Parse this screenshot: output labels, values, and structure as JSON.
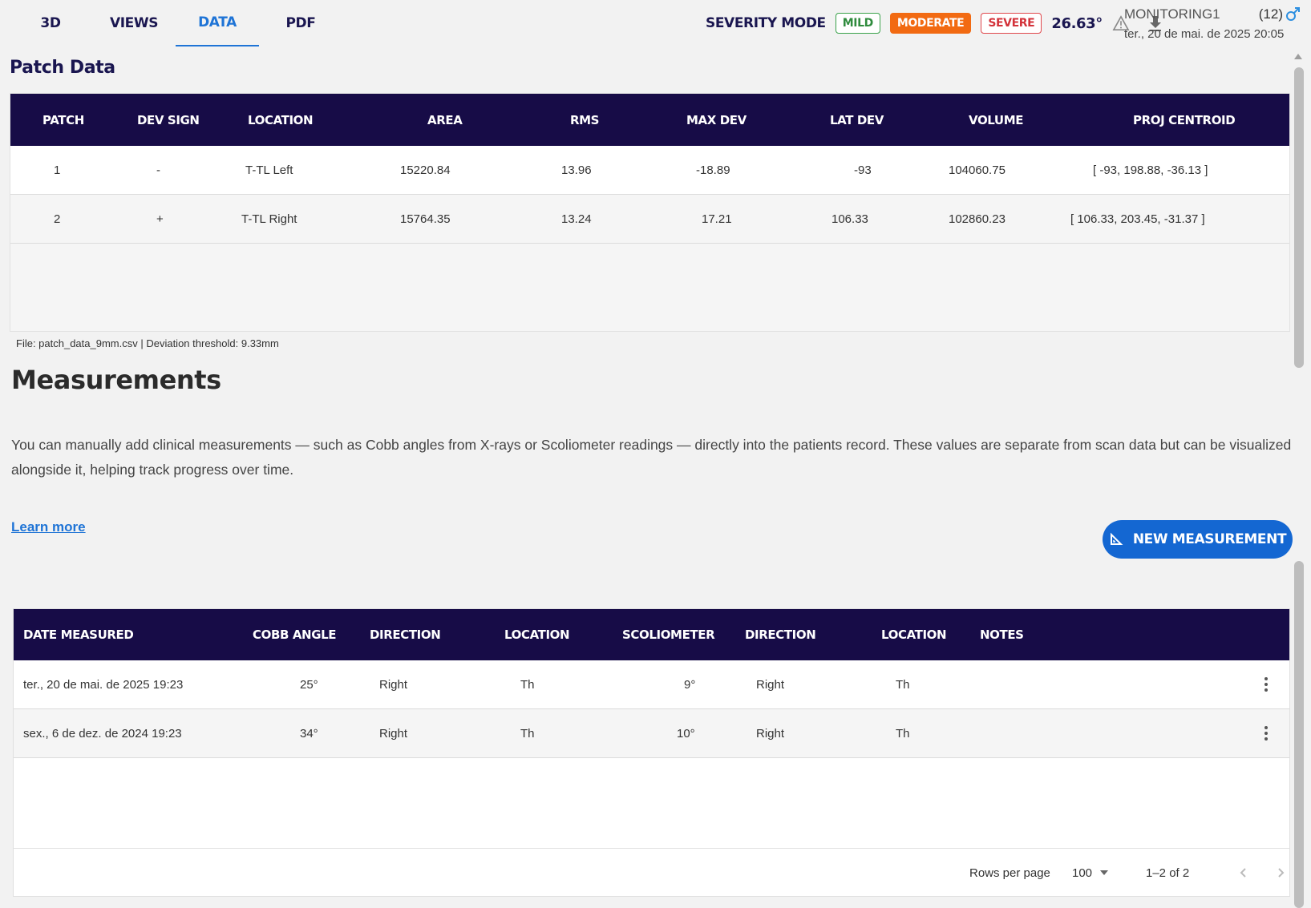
{
  "tabs": [
    "3D",
    "VIEWS",
    "DATA",
    "PDF"
  ],
  "severity": {
    "label": "SEVERITY MODE",
    "mild": "MILD",
    "moderate": "MODERATE",
    "severe": "SEVERE",
    "angle": "26.63°",
    "colors": {
      "mild": "#2f8b3d",
      "moderate": "#f26a12",
      "severe": "#d3323a"
    }
  },
  "patient": {
    "name": "MONITORING1",
    "count": "(12)",
    "date": "ter., 20 de mai. de 2025 20:05"
  },
  "patch": {
    "title": "Patch Data",
    "headers": [
      "PATCH",
      "DEV SIGN",
      "LOCATION",
      "AREA",
      "RMS",
      "MAX DEV",
      "LAT DEV",
      "VOLUME",
      "PROJ CENTROID"
    ],
    "rows": [
      [
        "1",
        "-",
        "T-TL Left",
        "15220.84",
        "13.96",
        "-18.89",
        "-93",
        "104060.75",
        "[ -93, 198.88, -36.13 ]"
      ],
      [
        "2",
        "+",
        "T-TL Right",
        "15764.35",
        "13.24",
        "17.21",
        "106.33",
        "102860.23",
        "[ 106.33, 203.45, -31.37 ]"
      ]
    ],
    "file_note": "File: patch_data_9mm.csv | Deviation threshold: 9.33mm"
  },
  "measurements": {
    "title": "Measurements",
    "description": "You can manually add clinical measurements — such as Cobb angles from X-rays or Scoliometer readings — directly into the patients record. These values are separate from scan data but can be visualized alongside it, helping track progress over time.",
    "learn_more": "Learn more",
    "new_button": "NEW MEASUREMENT",
    "headers": [
      "DATE MEASURED",
      "COBB ANGLE",
      "DIRECTION",
      "LOCATION",
      "SCOLIOMETER",
      "DIRECTION",
      "LOCATION",
      "NOTES"
    ],
    "rows": [
      [
        "ter., 20 de mai. de 2025 19:23",
        "25°",
        "Right",
        "Th",
        "9°",
        "Right",
        "Th",
        ""
      ],
      [
        "sex., 6 de dez. de 2024 19:23",
        "34°",
        "Right",
        "Th",
        "10°",
        "Right",
        "Th",
        ""
      ]
    ],
    "footer": {
      "rows_per_page_label": "Rows per page",
      "rows_per_page": "100",
      "range": "1–2 of 2"
    }
  },
  "icons": [
    "warning-icon",
    "download-icon",
    "male-icon",
    "ruler-icon",
    "more-vert-icon",
    "chevron-left-icon",
    "chevron-right-icon",
    "caret-down-icon",
    "scroll-up-icon"
  ]
}
